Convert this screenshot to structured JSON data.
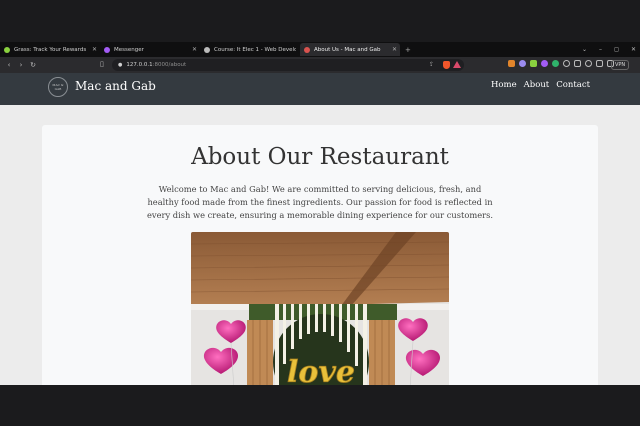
{
  "browser": {
    "tabs": [
      {
        "title": "Grass: Track Your Rewards",
        "favicon_color": "#8ad13f",
        "active": false
      },
      {
        "title": "Messenger",
        "favicon_color": "#a35cf5",
        "active": false
      },
      {
        "title": "Course: It Elec 1 - Web Developme",
        "favicon_color": "#bbbbbb",
        "active": false
      },
      {
        "title": "About Us - Mac and Gab",
        "favicon_color": "#d9534f",
        "active": true
      }
    ],
    "new_tab": "+",
    "address": {
      "host": "127.0.0.1",
      "path": ":8000/about"
    },
    "vpn_label": "VPN",
    "window_controls": [
      "⌄",
      "–",
      "◻",
      "✕"
    ]
  },
  "site": {
    "logo_text": "MAC & GAB",
    "brand": "Mac and Gab",
    "nav": [
      "Home",
      "About",
      "Contact"
    ],
    "heading": "About Our Restaurant",
    "paragraph": "Welcome to Mac and Gab! We are committed to serving delicious, fresh, and healthy food made from the finest ingredients. Our passion for food is reflected in every dish we create, ensuring a memorable dining experience for our customers.",
    "photo_text": "love"
  },
  "colors": {
    "navbar": "#343a40",
    "page_bg": "#ececec",
    "card_bg": "#f8f9fa",
    "heart_balloon": "#d81f8c",
    "letter_balloon": "#e9c13a",
    "ceiling_wood": "#9a6a42"
  }
}
